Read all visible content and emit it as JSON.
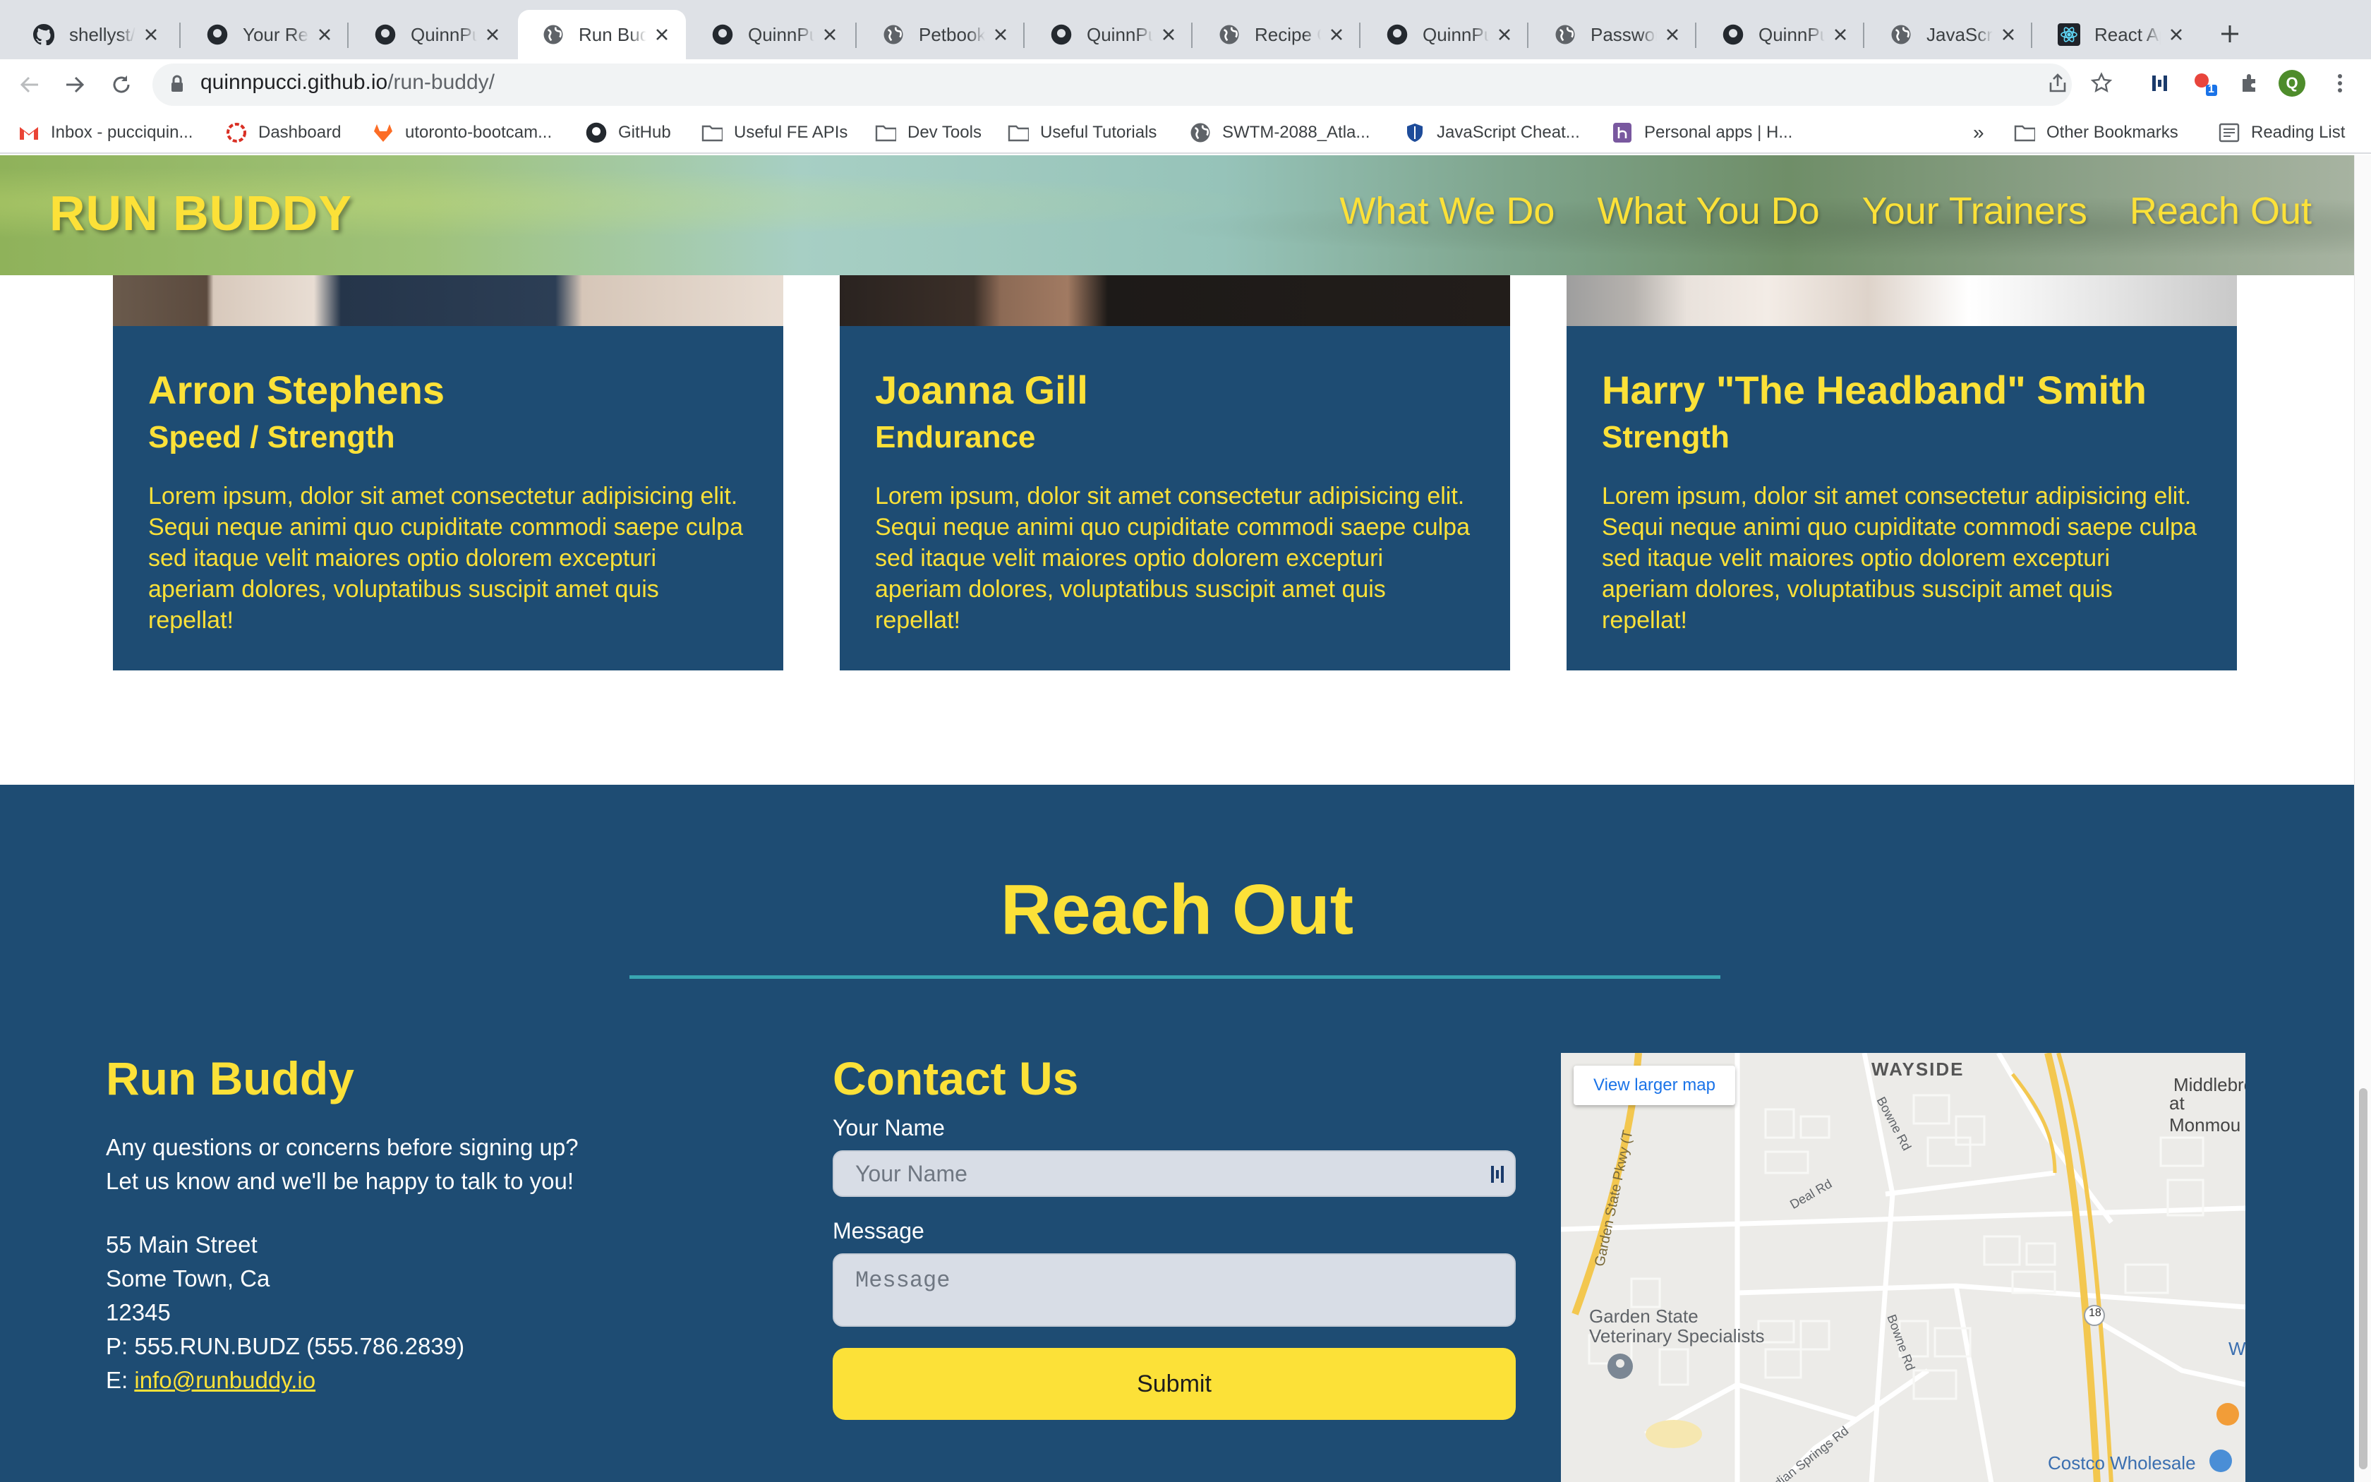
{
  "browser": {
    "tabs": [
      {
        "title": "shellyst/m",
        "icon": "github-icon"
      },
      {
        "title": "Your Repo",
        "icon": "github-icon"
      },
      {
        "title": "QuinnPuc",
        "icon": "github-icon"
      },
      {
        "title": "Run Budd",
        "icon": "globe-icon",
        "active": true
      },
      {
        "title": "QuinnPuc",
        "icon": "github-icon"
      },
      {
        "title": "Petbook",
        "icon": "globe-icon"
      },
      {
        "title": "QuinnPuc",
        "icon": "github-icon"
      },
      {
        "title": "Recipe Ge",
        "icon": "globe-icon"
      },
      {
        "title": "QuinnPuc",
        "icon": "github-icon"
      },
      {
        "title": "Password",
        "icon": "globe-icon"
      },
      {
        "title": "QuinnPuc",
        "icon": "github-icon"
      },
      {
        "title": "JavaScrip",
        "icon": "globe-icon"
      },
      {
        "title": "React Ap",
        "icon": "react-icon"
      }
    ],
    "url_host": "quinnpucci.github.io",
    "url_path": "/run-buddy/",
    "profile_initial": "Q",
    "extension_badge": "1",
    "bookmarks": [
      {
        "label": "Inbox - pucciquin...",
        "icon": "gmail-icon"
      },
      {
        "label": "Dashboard",
        "icon": "dashboard-icon"
      },
      {
        "label": "utoronto-bootcam...",
        "icon": "gitlab-icon"
      },
      {
        "label": "GitHub",
        "icon": "github-icon"
      },
      {
        "label": "Useful FE APIs",
        "icon": "folder-icon"
      },
      {
        "label": "Dev Tools",
        "icon": "folder-icon"
      },
      {
        "label": "Useful Tutorials",
        "icon": "folder-icon"
      },
      {
        "label": "SWTM-2088_Atla...",
        "icon": "globe-icon"
      },
      {
        "label": "JavaScript Cheat...",
        "icon": "shield-icon"
      },
      {
        "label": "Personal apps | H...",
        "icon": "heroku-icon"
      }
    ],
    "overflow_label": "»",
    "other_bookmarks": "Other Bookmarks",
    "reading_list": "Reading List"
  },
  "site": {
    "brand": "RUN BUDDY",
    "nav": [
      "What We Do",
      "What You Do",
      "Your Trainers",
      "Reach Out"
    ],
    "trainers": [
      {
        "name": "Arron Stephens",
        "role": "Speed / Strength",
        "bio": "Lorem ipsum, dolor sit amet consectetur adipisicing elit. Sequi neque animi quo cupiditate commodi saepe culpa sed itaque velit maiores optio dolorem excepturi aperiam dolores, voluptatibus suscipit amet quis repellat!"
      },
      {
        "name": "Joanna Gill",
        "role": "Endurance",
        "bio": "Lorem ipsum, dolor sit amet consectetur adipisicing elit. Sequi neque animi quo cupiditate commodi saepe culpa sed itaque velit maiores optio dolorem excepturi aperiam dolores, voluptatibus suscipit amet quis repellat!"
      },
      {
        "name": "Harry \"The Headband\" Smith",
        "role": "Strength",
        "bio": "Lorem ipsum, dolor sit amet consectetur adipisicing elit. Sequi neque animi quo cupiditate commodi saepe culpa sed itaque velit maiores optio dolorem excepturi aperiam dolores, voluptatibus suscipit amet quis repellat!"
      }
    ],
    "contact": {
      "title": "Reach Out",
      "info_title": "Run Buddy",
      "intro_line1": "Any questions or concerns before signing up?",
      "intro_line2": "Let us know and we'll be happy to talk to you!",
      "address1": "55 Main Street",
      "address2": "Some Town, Ca",
      "zip": "12345",
      "phone": "P: 555.RUN.BUDZ (555.786.2839)",
      "email_prefix": "E: ",
      "email": "info@runbuddy.io",
      "form_title": "Contact Us",
      "name_label": "Your Name",
      "name_placeholder": "Your Name",
      "message_label": "Message",
      "message_placeholder": "Message",
      "submit": "Submit"
    },
    "map": {
      "button": "View larger map",
      "labels": [
        "WAYSIDE",
        "Middlebro",
        "at Monmou",
        "Garden State Pkwy (T",
        "Bowne Rd",
        "Deal Rd",
        "Garden State",
        "Veterinary Specialists",
        "Bowne Rd",
        "Cold Indian Springs Rd",
        "18",
        "Costco Wholesale",
        "W"
      ]
    }
  },
  "colors": {
    "brand_blue": "#1e4c73",
    "brand_yellow": "#fce138",
    "rule_teal": "#39a6b2"
  }
}
